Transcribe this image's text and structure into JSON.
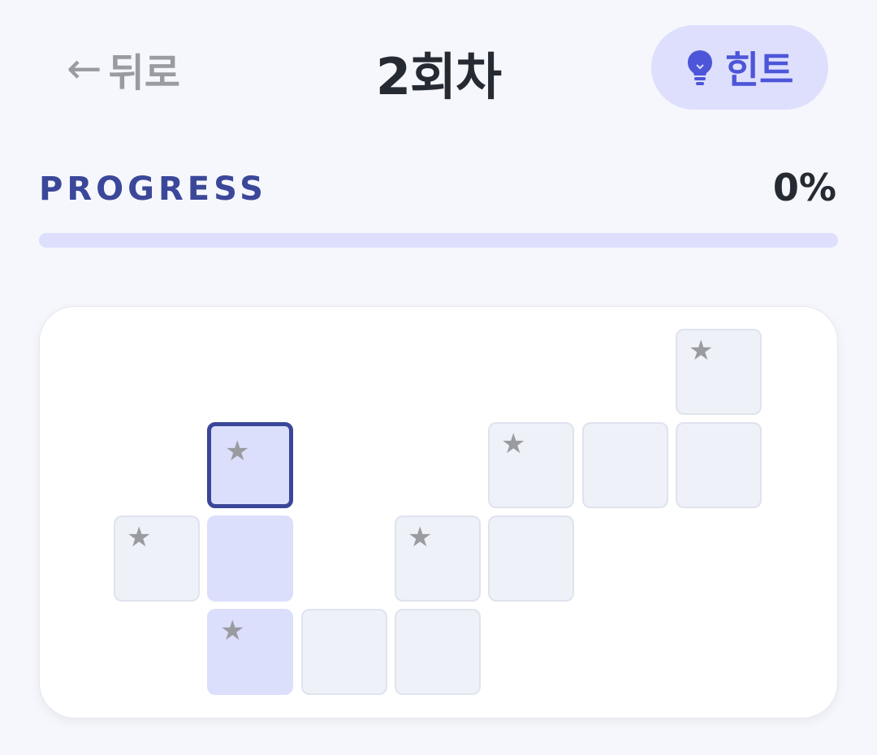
{
  "header": {
    "back_arrow": "←",
    "back_label": "뒤로",
    "title": "2회차",
    "hint_label": "힌트",
    "hint_icon": "lightbulb-icon"
  },
  "progress": {
    "label": "PROGRESS",
    "value_text": "0%",
    "value": 0
  },
  "board": {
    "star_glyph": "★",
    "cells": [
      {
        "id": "r0c6",
        "star": true,
        "state": "empty"
      },
      {
        "id": "r1c1",
        "star": true,
        "state": "selected"
      },
      {
        "id": "r1c4",
        "star": true,
        "state": "empty"
      },
      {
        "id": "r1c5",
        "star": false,
        "state": "empty"
      },
      {
        "id": "r1c6",
        "star": false,
        "state": "empty"
      },
      {
        "id": "r2c0",
        "star": true,
        "state": "empty"
      },
      {
        "id": "r2c1",
        "star": false,
        "state": "highlight"
      },
      {
        "id": "r2c3",
        "star": true,
        "state": "empty"
      },
      {
        "id": "r2c4",
        "star": false,
        "state": "empty"
      },
      {
        "id": "r3c1",
        "star": true,
        "state": "highlight"
      },
      {
        "id": "r3c2",
        "star": false,
        "state": "empty"
      },
      {
        "id": "r3c3",
        "star": false,
        "state": "empty"
      }
    ]
  },
  "colors": {
    "accent": "#4d55d8",
    "accent_dark": "#3a4698",
    "highlight": "#dcdffb",
    "cell": "#eff1f9",
    "star": "#9a9ba1"
  }
}
